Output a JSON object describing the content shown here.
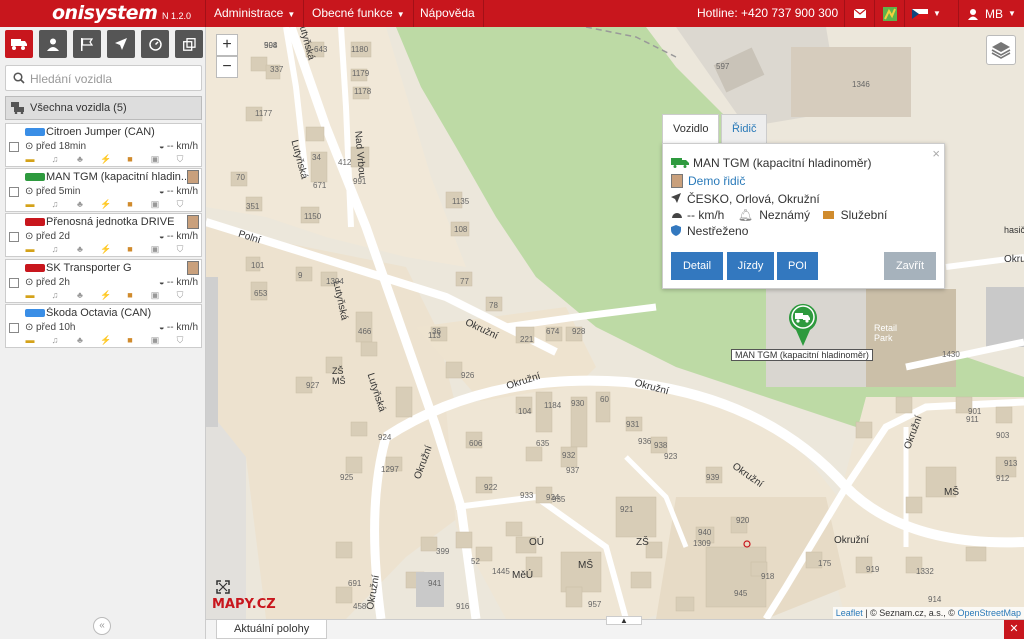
{
  "app": {
    "logo": "onisystem",
    "version": "N 1.2.0"
  },
  "menu": [
    {
      "label": "Administrace",
      "caret": true
    },
    {
      "label": "Obecné funkce",
      "caret": true
    },
    {
      "label": "Nápověda",
      "caret": false
    }
  ],
  "header_right": {
    "hotline": "Hotline: +420 737 900 300",
    "user": "MB",
    "language_icon": "czech-flag-icon"
  },
  "toolbar": {
    "buttons": [
      "truck-icon",
      "person-icon",
      "flags-icon",
      "navigation-arrow-icon",
      "speedometer-icon",
      "copy-icon"
    ]
  },
  "search": {
    "placeholder": "Hledání vozidla"
  },
  "all_vehicles_label": "Všechna vozidla (5)",
  "vehicles": [
    {
      "name": "Citroen Jumper (CAN)",
      "time": "před 18min",
      "speed": "-- km/h",
      "color": "#3a8ee6",
      "has_avatar": false
    },
    {
      "name": "MAN TGM (kapacitní hladin...",
      "time": "před 5min",
      "speed": "-- km/h",
      "color": "#2e9a3e",
      "has_avatar": true
    },
    {
      "name": "Přenosná jednotka DRIVE",
      "time": "před 2d",
      "speed": "-- km/h",
      "color": "#c8161d",
      "has_avatar": true
    },
    {
      "name": "SK Transporter G",
      "time": "před 2h",
      "speed": "-- km/h",
      "color": "#c8161d",
      "has_avatar": true
    },
    {
      "name": "Škoda Octavia (CAN)",
      "time": "před 10h",
      "speed": "-- km/h",
      "color": "#3a8ee6",
      "has_avatar": false
    }
  ],
  "popup": {
    "tabs": [
      "Vozidlo",
      "Řidič"
    ],
    "vehicle_name": "MAN TGM (kapacitní hladinoměr)",
    "driver": "Demo řidič",
    "location": "ČESKO, Orlová, Okružní",
    "speed": "-- km/h",
    "alarm": "Neznámý",
    "usage": "Služební",
    "security": "Nestřeženo",
    "buttons": [
      "Detail",
      "Jízdy",
      "POI"
    ],
    "close_button": "Zavřít",
    "x": "×"
  },
  "map": {
    "marker_label": "MAN TGM (kapacitní hladinoměr)",
    "zoom_in": "+",
    "zoom_out": "−",
    "logo": "MAPY.CZ",
    "streets": [
      "Lutyňská",
      "Lutyňská",
      "Lutyňská",
      "Nad Vrbou",
      "Polní",
      "Okružní",
      "Okružní",
      "Okružní",
      "Okružní",
      "Okružní",
      "Okružní",
      "Okružní",
      "Okružní"
    ],
    "places": [
      "ZŠ MŠ",
      "ZŠ",
      "MŠ",
      "MŠ",
      "MěÚ",
      "OÚ",
      "Retail Park",
      "hasič"
    ],
    "building_numbers": [
      "598",
      "643",
      "1180",
      "337",
      "1179",
      "1178",
      "1177",
      "34",
      "70",
      "671",
      "412",
      "991",
      "351",
      "1150",
      "1135",
      "108",
      "101",
      "653",
      "9",
      "1304",
      "77",
      "78",
      "113",
      "466",
      "36",
      "221",
      "674",
      "928",
      "927",
      "926",
      "1184",
      "930",
      "104",
      "60",
      "931",
      "938",
      "925",
      "924",
      "1297",
      "606",
      "635",
      "932",
      "937",
      "936",
      "923",
      "922",
      "933",
      "934",
      "935",
      "939",
      "921",
      "940",
      "920",
      "1309",
      "399",
      "52",
      "1445",
      "175",
      "919",
      "918",
      "945",
      "1332",
      "914",
      "916",
      "957",
      "941",
      "691",
      "458",
      "597",
      "1346",
      "1430",
      "901",
      "903",
      "913",
      "912",
      "911",
      "904"
    ]
  },
  "bottom": {
    "tab_label": "Aktuální polohy",
    "close": "✕",
    "collapse": "«"
  },
  "attribution": {
    "leaflet": "Leaflet",
    "seznam": " | © Seznam.cz, a.s., © ",
    "osm": "OpenStreetMap"
  },
  "colors": {
    "brand_red": "#c8161d",
    "button_blue": "#3378bf",
    "button_gray": "#a6b2bc",
    "park_green": "#bddaa5",
    "marker_green": "#2e9a3e"
  }
}
